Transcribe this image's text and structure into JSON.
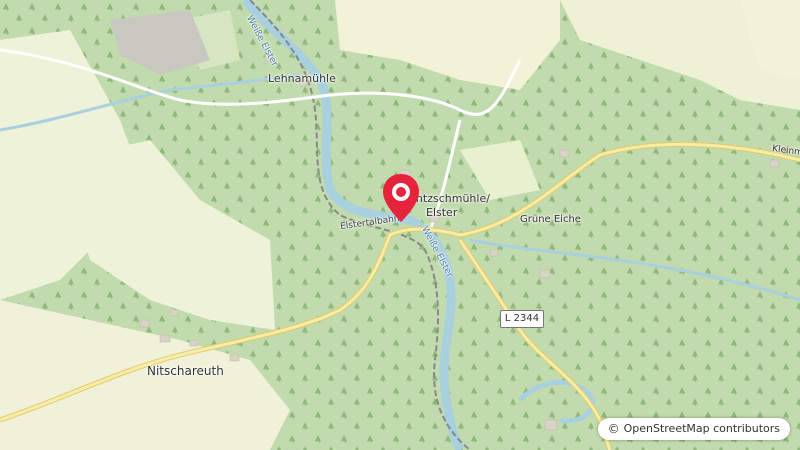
{
  "map": {
    "places": [
      {
        "name": "Lehnamühle"
      },
      {
        "name": "Nitschareuth"
      },
      {
        "name": "Grüne Eiche"
      },
      {
        "name": "Rentzschmühle/"
      },
      {
        "name": "Elster"
      },
      {
        "name": "Kleinm"
      }
    ],
    "river_label": "Weiße Elster",
    "river_label_2": "Weiße Elster",
    "railway_label": "Elstertalbahn",
    "road_ref": "L 2344",
    "attribution": "OpenStreetMap contributors",
    "attribution_symbol": "©",
    "colors": {
      "forest": "#c3dbb0",
      "meadow": "#f1f0d9",
      "farmland": "#eef0dc",
      "water": "#a8d0df",
      "road_primary": "#f5e8a3",
      "road_minor": "#ffffff",
      "marker": "#e5243b"
    }
  }
}
